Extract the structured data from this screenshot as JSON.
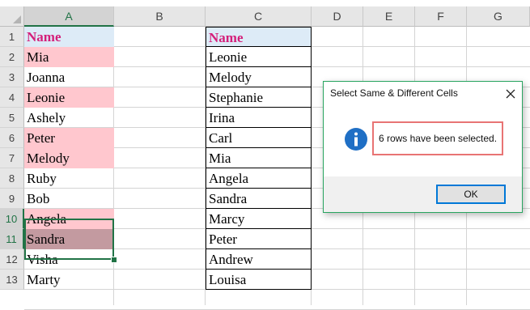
{
  "columns": [
    "A",
    "B",
    "C",
    "D",
    "E",
    "F",
    "G"
  ],
  "rows": [
    "1",
    "2",
    "3",
    "4",
    "5",
    "6",
    "7",
    "8",
    "9",
    "10",
    "11",
    "12",
    "13"
  ],
  "column_a": [
    "Name",
    "Mia",
    "Joanna",
    "Leonie",
    "Ashely",
    "Peter",
    "Melody",
    "Ruby",
    "Bob",
    "Angela",
    "Sandra",
    "Visha",
    "Marty"
  ],
  "column_c": [
    "Name",
    "Leonie",
    "Melody",
    "Stephanie",
    "Irina",
    "Carl",
    "Mia",
    "Angela",
    "Sandra",
    "Marcy",
    "Peter",
    "Andrew",
    "Louisa"
  ],
  "colors": {
    "header_text": "#d41f7a",
    "header_fill": "#ddebf7",
    "highlight_fill": "#ffc7ce",
    "selected_highlight_fill": "#c39aa0",
    "excel_green": "#217346"
  },
  "highlighted_rows_a": [
    "2",
    "4",
    "6",
    "7",
    "10",
    "11"
  ],
  "selection": "A10:A11",
  "dialog": {
    "title": "Select Same & Different Cells",
    "message": "6 rows have been selected.",
    "ok_label": "OK",
    "icon": "info-icon",
    "close_icon": "close-icon"
  }
}
